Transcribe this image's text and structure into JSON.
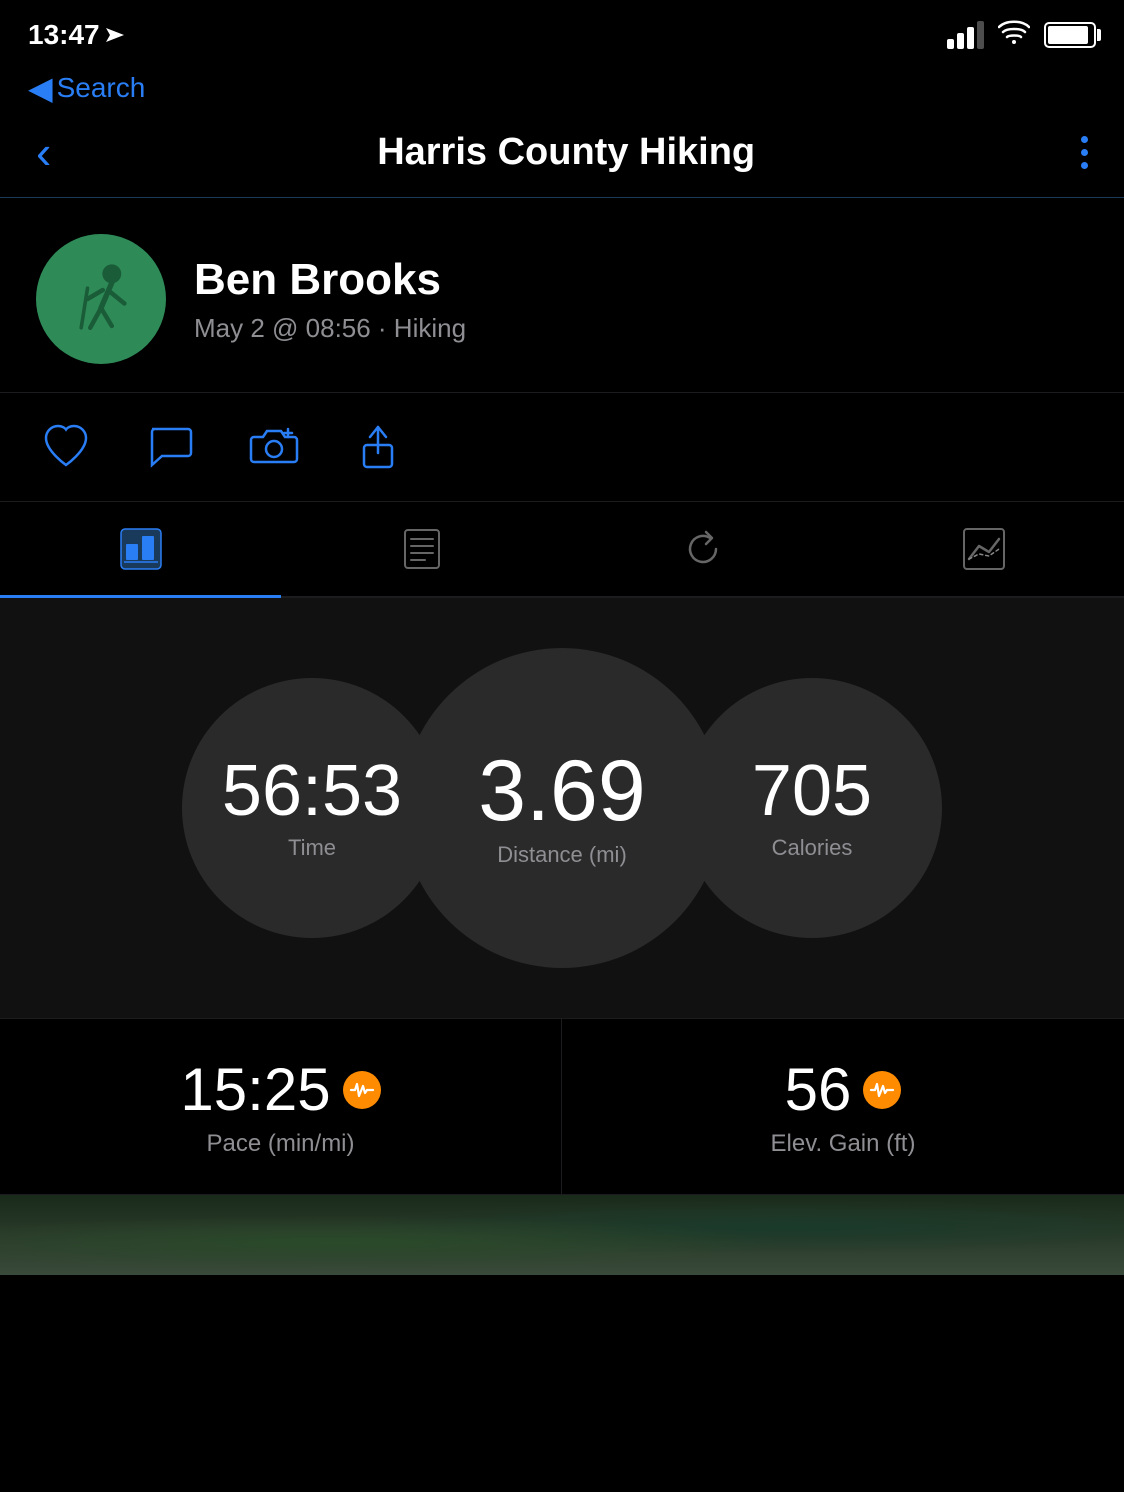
{
  "status_bar": {
    "time": "13:47",
    "back_label": "Search"
  },
  "nav_bar": {
    "title": "Harris County Hiking",
    "back_icon": "chevron-left",
    "more_icon": "three-dots-vertical"
  },
  "profile": {
    "name": "Ben Brooks",
    "meta": "May 2 @ 08:56 · Hiking",
    "avatar_alt": "hiking-person-icon"
  },
  "actions": [
    {
      "id": "like",
      "label": "Like",
      "icon": "heart-icon"
    },
    {
      "id": "comment",
      "label": "Comment",
      "icon": "comment-icon"
    },
    {
      "id": "photo",
      "label": "Add Photo",
      "icon": "camera-plus-icon"
    },
    {
      "id": "share",
      "label": "Share",
      "icon": "share-icon"
    }
  ],
  "tabs": [
    {
      "id": "overview",
      "label": "Overview",
      "icon": "overview-icon",
      "active": true
    },
    {
      "id": "details",
      "label": "Details",
      "icon": "list-icon",
      "active": false
    },
    {
      "id": "history",
      "label": "History",
      "icon": "refresh-icon",
      "active": false
    },
    {
      "id": "chart",
      "label": "Chart",
      "icon": "chart-icon",
      "active": false
    }
  ],
  "stats": {
    "time": {
      "value": "56:53",
      "label": "Time",
      "ring_color": "#6a5acd"
    },
    "distance": {
      "value": "3.69",
      "label": "Distance (mi)",
      "ring_color": "#ff8c00"
    },
    "calories": {
      "value": "705",
      "label": "Calories",
      "ring_color": "#32cd32"
    }
  },
  "bottom_stats": [
    {
      "value": "15:25",
      "label": "Pace (min/mi)",
      "has_badge": true
    },
    {
      "value": "56",
      "label": "Elev. Gain (ft)",
      "has_badge": true
    }
  ]
}
